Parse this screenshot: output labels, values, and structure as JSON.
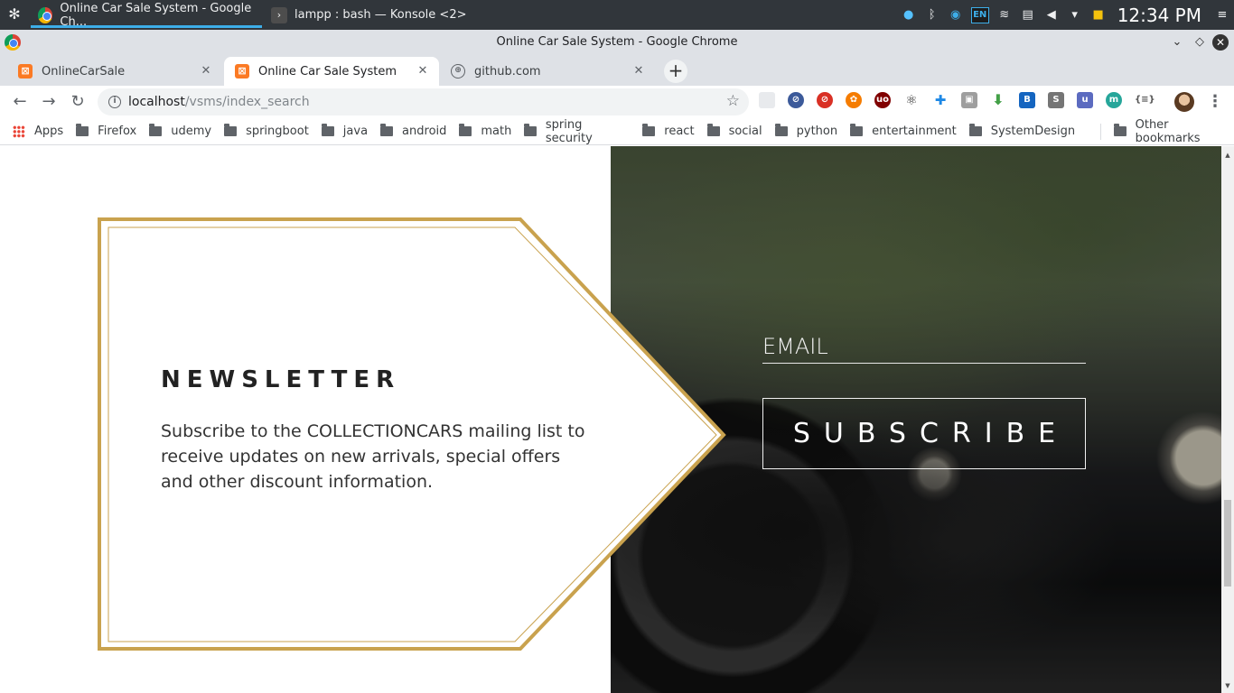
{
  "panel": {
    "tasks": [
      {
        "label": "Online Car Sale System - Google Ch...",
        "active": true
      },
      {
        "label": "lampp : bash — Konsole <2>",
        "active": false
      }
    ],
    "tray": {
      "lang": "EN",
      "clock": "12:34 PM"
    }
  },
  "window": {
    "title": "Online Car Sale System - Google Chrome"
  },
  "tabs": [
    {
      "label": "OnlineCarSale",
      "active": false
    },
    {
      "label": "Online Car Sale System",
      "active": true
    },
    {
      "label": "github.com",
      "active": false
    }
  ],
  "address": {
    "host": "localhost",
    "path": "/vsms/index_search"
  },
  "bookmarks": {
    "apps": "Apps",
    "folders": [
      "Firefox",
      "udemy",
      "springboot",
      "java",
      "android",
      "math",
      "spring security",
      "react",
      "social",
      "python",
      "entertainment",
      "SystemDesign"
    ],
    "other": "Other bookmarks"
  },
  "newsletter": {
    "heading": "NEWSLETTER",
    "text": "Subscribe to the COLLECTIONCARS mailing list to receive updates on new arrivals, special offers and other discount information.",
    "email_placeholder": "EMAIL",
    "subscribe_label": "SUBSCRIBE"
  },
  "colors": {
    "frame_gold": "#c9a24e",
    "chrome_accent": "#3daee9"
  }
}
